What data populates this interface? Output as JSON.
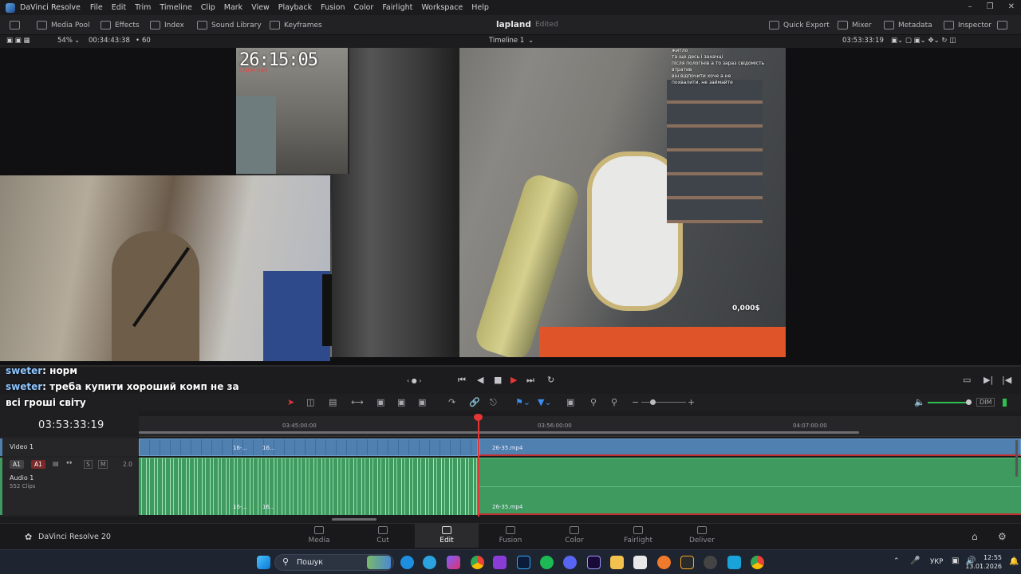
{
  "titlebar": {
    "app_name": "DaVinci Resolve",
    "menu": [
      "File",
      "Edit",
      "Trim",
      "Timeline",
      "Clip",
      "Mark",
      "View",
      "Playback",
      "Fusion",
      "Color",
      "Fairlight",
      "Workspace",
      "Help"
    ]
  },
  "toolbar": {
    "media_pool": "Media Pool",
    "effects": "Effects",
    "index": "Index",
    "sound_library": "Sound Library",
    "keyframes": "Keyframes",
    "project_title": "lapland",
    "project_status": "Edited",
    "quick_export": "Quick Export",
    "mixer": "Mixer",
    "metadata": "Metadata",
    "inspector": "Inspector"
  },
  "viewerbar": {
    "zoom": "54%",
    "source_timecode": "00:34:43:38",
    "fps": "60",
    "timeline_name": "Timeline 1",
    "record_timecode": "03:53:33:19"
  },
  "viewer": {
    "overlay_timecode": "26:15:05",
    "stream_label": "стрім йде",
    "donation_amount": "0,000$",
    "chat_overlay_lines": [
      "житло",
      "та ще десь і заначці",
      "після пологінів а то зараз свідомість втратив",
      "він відпочити хоче а не",
      "похвалити, не займайте"
    ]
  },
  "chat": {
    "line1_user": "sweter",
    "line1_text": ": норм",
    "line2_user": "sweter",
    "line2_text": ": треба купити хороший комп не за",
    "line3_text": "всі гроші світу"
  },
  "timeline": {
    "current_timecode": "03:53:33:19",
    "ruler_labels": [
      "03:45:00:00",
      "03:56:00:00",
      "04:07:00:00"
    ],
    "video_track_name": "Video 1",
    "audio_track_name": "Audio 1",
    "audio_clip_count": "552 Clips",
    "audio_channel": "2.0",
    "track_buttons": [
      "A1",
      "A1",
      "S",
      "M"
    ],
    "clips": {
      "short_clip_a": "16-...",
      "short_clip_b": "16...",
      "current_clip": "26-35.mp4"
    },
    "dim_label": "DIM"
  },
  "pagenav": {
    "brand": "DaVinci Resolve 20",
    "pages": [
      "Media",
      "Cut",
      "Edit",
      "Fusion",
      "Color",
      "Fairlight",
      "Deliver"
    ],
    "active": "Edit"
  },
  "taskbar": {
    "search_placeholder": "Пошук",
    "language": "УКР",
    "time": "12:55",
    "date": "13.01.2026"
  }
}
